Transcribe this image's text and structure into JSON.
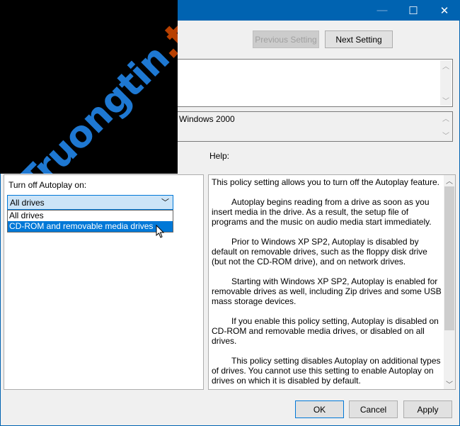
{
  "titlebar": {
    "minimize": "—",
    "maximize": "☐",
    "close": "✕"
  },
  "nav": {
    "previous": "Previous Setting",
    "next": "Next Setting"
  },
  "comment": {
    "value": ""
  },
  "supported_on": {
    "value": "Windows 2000"
  },
  "help_label": "Help:",
  "options": {
    "label": "Turn off Autoplay on:",
    "selected": "All drives",
    "items": [
      "All drives",
      "CD-ROM and removable media drives"
    ],
    "highlighted_index": 1
  },
  "help": {
    "paragraphs": [
      "This policy setting allows you to turn off the Autoplay feature.",
      "Autoplay begins reading from a drive as soon as you insert media in the drive. As a result, the setup file of programs and the music on audio media start immediately.",
      "Prior to Windows XP SP2, Autoplay is disabled by default on removable drives, such as the floppy disk drive (but not the CD-ROM drive), and on network drives.",
      "Starting with Windows XP SP2, Autoplay is enabled for removable drives as well, including Zip drives and some USB mass storage devices.",
      "If you enable this policy setting, Autoplay is disabled on CD-ROM and removable media drives, or disabled on all drives.",
      "This policy setting disables Autoplay on additional types of drives. You cannot use this setting to enable Autoplay on drives on which it is disabled by default."
    ]
  },
  "footer": {
    "ok": "OK",
    "cancel": "Cancel",
    "apply": "Apply"
  },
  "watermark": {
    "part1": "Truongtin",
    "part2": ".top"
  },
  "colors": {
    "titlebar": "#0063b1",
    "selection": "#0078d7",
    "watermark_blue": "#1e78d2",
    "watermark_orange": "#b84000"
  }
}
